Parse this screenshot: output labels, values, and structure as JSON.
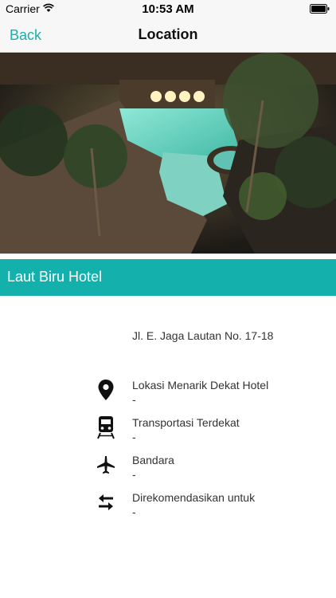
{
  "status_bar": {
    "carrier": "Carrier",
    "time": "10:53 AM",
    "icons": [
      "wifi-icon",
      "battery-icon"
    ]
  },
  "nav": {
    "back_label": "Back",
    "title": "Location"
  },
  "hero": {
    "description_icon": "hotel-pool-photo"
  },
  "hotel": {
    "name": "Laut Biru Hotel",
    "address": "Jl. E. Jaga Lautan No. 17-18"
  },
  "info": [
    {
      "icon": "map-pin-icon",
      "title": "Lokasi Menarik Dekat Hotel",
      "value": "-"
    },
    {
      "icon": "train-icon",
      "title": "Transportasi Terdekat",
      "value": "-"
    },
    {
      "icon": "airplane-icon",
      "title": "Bandara",
      "value": "-"
    },
    {
      "icon": "swap-arrows-icon",
      "title": "Direkomendasikan untuk",
      "value": "-"
    }
  ],
  "colors": {
    "accent": "#14b1ac",
    "back_text": "#1ab0ab",
    "nav_bg": "#f7f7f7"
  }
}
